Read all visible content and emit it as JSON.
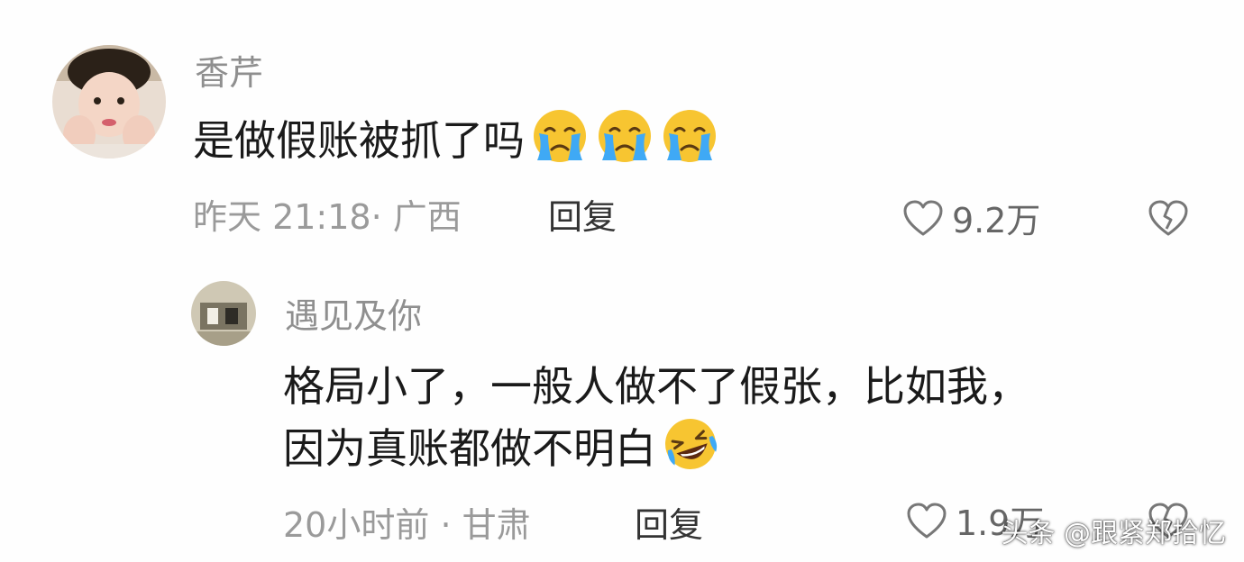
{
  "comments": [
    {
      "username": "香芹",
      "text": "是做假账被抓了吗",
      "emojis": [
        "crying-face",
        "crying-face",
        "crying-face"
      ],
      "time": "昨天 21:18",
      "location": "广西",
      "reply_label": "回复",
      "likes": "9.2万"
    },
    {
      "username": "遇见及你",
      "text_line1": "格局小了，一般人做不了假张，比如我，",
      "text_line2": "因为真账都做不明白",
      "emojis": [
        "rolling-laughing-face"
      ],
      "time": "20小时前",
      "location": "甘肃",
      "reply_label": "回复",
      "likes": "1.9万"
    }
  ],
  "watermark": "头条 @跟紧郑拾忆",
  "colors": {
    "username": "#8f8f8f",
    "meta": "#9a9a9a",
    "text": "#1a1a1a",
    "emoji_yellow": "#f7c531",
    "tear_blue": "#3fa9f5"
  }
}
